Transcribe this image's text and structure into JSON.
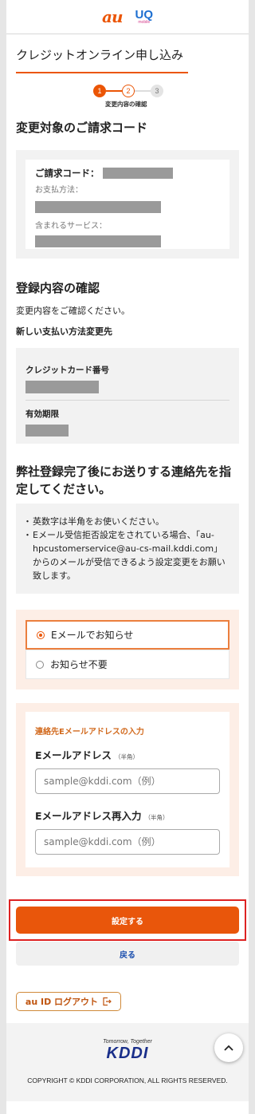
{
  "header": {
    "au_logo": "au",
    "uq_logo": "UQ",
    "uq_sub": "mobile"
  },
  "title": "クレジットオンライン申し込み",
  "steps": {
    "items": [
      "1",
      "2",
      "3"
    ],
    "current": 1,
    "label": "変更内容の確認"
  },
  "billing": {
    "heading": "変更対象のご請求コード",
    "code_label": "ご請求コード：",
    "payment_label": "お支払方法：",
    "services_label": "含まれるサービス："
  },
  "registration": {
    "heading": "登録内容の確認",
    "instruction": "変更内容をご確認ください。",
    "subheading": "新しい支払い方法変更先",
    "card_label": "クレジットカード番号",
    "expiry_label": "有効期限"
  },
  "contact": {
    "heading": "弊社登録完了後にお送りする連絡先を指定してください。",
    "notes": [
      "英数字は半角をお使いください。",
      "Eメール受信拒否設定をされている場合、「au-hpcustomerservice@au-cs-mail.kddi.com」からのメールが受信できるよう設定変更をお願い致します。"
    ],
    "options": [
      "Eメールでお知らせ",
      "お知らせ不要"
    ],
    "selected": "Eメールでお知らせ"
  },
  "email_form": {
    "heading": "連絡先Eメールアドレスの入力",
    "email_label": "Eメールアドレス",
    "email_hint": "（半角）",
    "email_placeholder": "sample@kddi.com（例）",
    "email_value": "",
    "confirm_label": "Eメールアドレス再入力",
    "confirm_hint": "（半角）",
    "confirm_placeholder": "sample@kddi.com（例）",
    "confirm_value": ""
  },
  "actions": {
    "submit": "設定する",
    "back": "戻る",
    "logout": "au ID ログアウト"
  },
  "footer": {
    "tagline": "Tomorrow, Together",
    "brand": "KDDI",
    "copyright": "COPYRIGHT © KDDI CORPORATION, ALL RIGHTS RESERVED.",
    "top_icon": "chevron-up-icon"
  },
  "colors": {
    "accent": "#eb5505",
    "link": "#1b4fae",
    "peach": "#fdeee6",
    "mask": "#9a9a9a"
  }
}
